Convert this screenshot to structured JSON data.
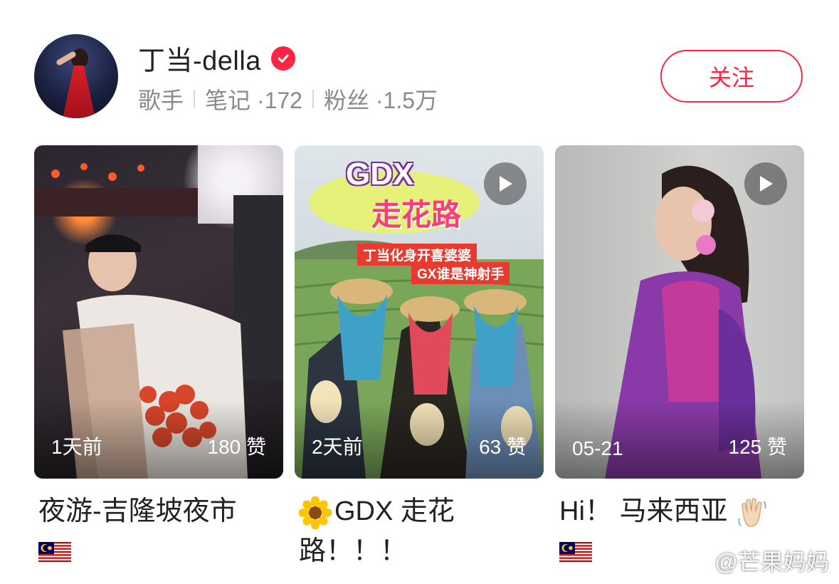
{
  "profile": {
    "name": "丁当-della",
    "role": "歌手",
    "notes": "笔记 ·172",
    "fans": "粉丝 ·1.5万",
    "follow_label": "关注"
  },
  "posts": [
    {
      "time": "1天前",
      "likes": "180 赞",
      "title": "夜游-吉隆坡夜市",
      "has_video": false
    },
    {
      "time": "2天前",
      "likes": "63 赞",
      "title": "GDX 走花路！！！",
      "has_video": true,
      "cover_text": {
        "logo": "GDX",
        "logo_sub": "走花路",
        "line1": "丁当化身开喜婆婆",
        "line2": "GX谁是神射手"
      }
    },
    {
      "time": "05-21",
      "likes": "125 赞",
      "title": "Hi！ 马来西亚",
      "has_video": true
    }
  ],
  "watermark": "@芒果妈妈",
  "colors": {
    "accent": "#ff2442",
    "meta": "#8a8a8a"
  }
}
